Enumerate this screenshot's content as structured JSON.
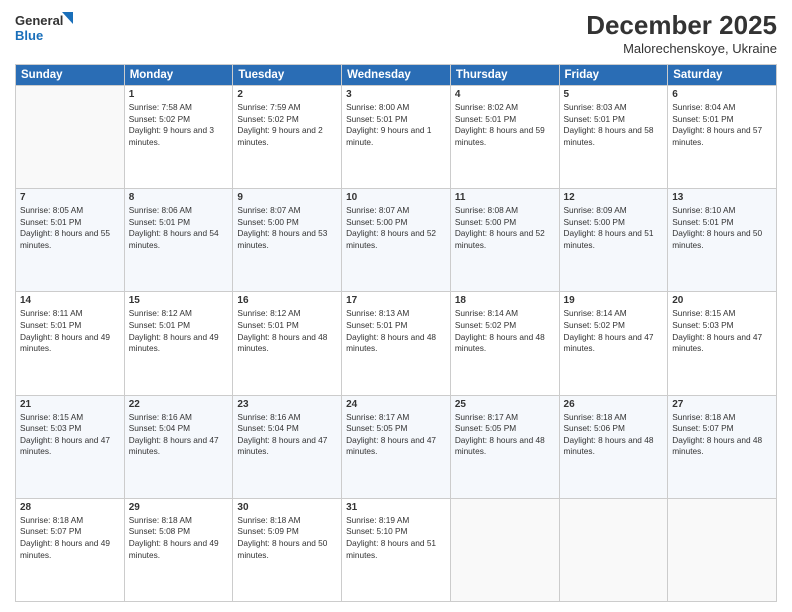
{
  "logo": {
    "line1": "General",
    "line2": "Blue"
  },
  "title": "December 2025",
  "subtitle": "Malorechenskoye, Ukraine",
  "weekdays": [
    "Sunday",
    "Monday",
    "Tuesday",
    "Wednesday",
    "Thursday",
    "Friday",
    "Saturday"
  ],
  "weeks": [
    [
      {
        "day": "",
        "sunrise": "",
        "sunset": "",
        "daylight": ""
      },
      {
        "day": "1",
        "sunrise": "Sunrise: 7:58 AM",
        "sunset": "Sunset: 5:02 PM",
        "daylight": "Daylight: 9 hours and 3 minutes."
      },
      {
        "day": "2",
        "sunrise": "Sunrise: 7:59 AM",
        "sunset": "Sunset: 5:02 PM",
        "daylight": "Daylight: 9 hours and 2 minutes."
      },
      {
        "day": "3",
        "sunrise": "Sunrise: 8:00 AM",
        "sunset": "Sunset: 5:01 PM",
        "daylight": "Daylight: 9 hours and 1 minute."
      },
      {
        "day": "4",
        "sunrise": "Sunrise: 8:02 AM",
        "sunset": "Sunset: 5:01 PM",
        "daylight": "Daylight: 8 hours and 59 minutes."
      },
      {
        "day": "5",
        "sunrise": "Sunrise: 8:03 AM",
        "sunset": "Sunset: 5:01 PM",
        "daylight": "Daylight: 8 hours and 58 minutes."
      },
      {
        "day": "6",
        "sunrise": "Sunrise: 8:04 AM",
        "sunset": "Sunset: 5:01 PM",
        "daylight": "Daylight: 8 hours and 57 minutes."
      }
    ],
    [
      {
        "day": "7",
        "sunrise": "Sunrise: 8:05 AM",
        "sunset": "Sunset: 5:01 PM",
        "daylight": "Daylight: 8 hours and 55 minutes."
      },
      {
        "day": "8",
        "sunrise": "Sunrise: 8:06 AM",
        "sunset": "Sunset: 5:01 PM",
        "daylight": "Daylight: 8 hours and 54 minutes."
      },
      {
        "day": "9",
        "sunrise": "Sunrise: 8:07 AM",
        "sunset": "Sunset: 5:00 PM",
        "daylight": "Daylight: 8 hours and 53 minutes."
      },
      {
        "day": "10",
        "sunrise": "Sunrise: 8:07 AM",
        "sunset": "Sunset: 5:00 PM",
        "daylight": "Daylight: 8 hours and 52 minutes."
      },
      {
        "day": "11",
        "sunrise": "Sunrise: 8:08 AM",
        "sunset": "Sunset: 5:00 PM",
        "daylight": "Daylight: 8 hours and 52 minutes."
      },
      {
        "day": "12",
        "sunrise": "Sunrise: 8:09 AM",
        "sunset": "Sunset: 5:00 PM",
        "daylight": "Daylight: 8 hours and 51 minutes."
      },
      {
        "day": "13",
        "sunrise": "Sunrise: 8:10 AM",
        "sunset": "Sunset: 5:01 PM",
        "daylight": "Daylight: 8 hours and 50 minutes."
      }
    ],
    [
      {
        "day": "14",
        "sunrise": "Sunrise: 8:11 AM",
        "sunset": "Sunset: 5:01 PM",
        "daylight": "Daylight: 8 hours and 49 minutes."
      },
      {
        "day": "15",
        "sunrise": "Sunrise: 8:12 AM",
        "sunset": "Sunset: 5:01 PM",
        "daylight": "Daylight: 8 hours and 49 minutes."
      },
      {
        "day": "16",
        "sunrise": "Sunrise: 8:12 AM",
        "sunset": "Sunset: 5:01 PM",
        "daylight": "Daylight: 8 hours and 48 minutes."
      },
      {
        "day": "17",
        "sunrise": "Sunrise: 8:13 AM",
        "sunset": "Sunset: 5:01 PM",
        "daylight": "Daylight: 8 hours and 48 minutes."
      },
      {
        "day": "18",
        "sunrise": "Sunrise: 8:14 AM",
        "sunset": "Sunset: 5:02 PM",
        "daylight": "Daylight: 8 hours and 48 minutes."
      },
      {
        "day": "19",
        "sunrise": "Sunrise: 8:14 AM",
        "sunset": "Sunset: 5:02 PM",
        "daylight": "Daylight: 8 hours and 47 minutes."
      },
      {
        "day": "20",
        "sunrise": "Sunrise: 8:15 AM",
        "sunset": "Sunset: 5:03 PM",
        "daylight": "Daylight: 8 hours and 47 minutes."
      }
    ],
    [
      {
        "day": "21",
        "sunrise": "Sunrise: 8:15 AM",
        "sunset": "Sunset: 5:03 PM",
        "daylight": "Daylight: 8 hours and 47 minutes."
      },
      {
        "day": "22",
        "sunrise": "Sunrise: 8:16 AM",
        "sunset": "Sunset: 5:04 PM",
        "daylight": "Daylight: 8 hours and 47 minutes."
      },
      {
        "day": "23",
        "sunrise": "Sunrise: 8:16 AM",
        "sunset": "Sunset: 5:04 PM",
        "daylight": "Daylight: 8 hours and 47 minutes."
      },
      {
        "day": "24",
        "sunrise": "Sunrise: 8:17 AM",
        "sunset": "Sunset: 5:05 PM",
        "daylight": "Daylight: 8 hours and 47 minutes."
      },
      {
        "day": "25",
        "sunrise": "Sunrise: 8:17 AM",
        "sunset": "Sunset: 5:05 PM",
        "daylight": "Daylight: 8 hours and 48 minutes."
      },
      {
        "day": "26",
        "sunrise": "Sunrise: 8:18 AM",
        "sunset": "Sunset: 5:06 PM",
        "daylight": "Daylight: 8 hours and 48 minutes."
      },
      {
        "day": "27",
        "sunrise": "Sunrise: 8:18 AM",
        "sunset": "Sunset: 5:07 PM",
        "daylight": "Daylight: 8 hours and 48 minutes."
      }
    ],
    [
      {
        "day": "28",
        "sunrise": "Sunrise: 8:18 AM",
        "sunset": "Sunset: 5:07 PM",
        "daylight": "Daylight: 8 hours and 49 minutes."
      },
      {
        "day": "29",
        "sunrise": "Sunrise: 8:18 AM",
        "sunset": "Sunset: 5:08 PM",
        "daylight": "Daylight: 8 hours and 49 minutes."
      },
      {
        "day": "30",
        "sunrise": "Sunrise: 8:18 AM",
        "sunset": "Sunset: 5:09 PM",
        "daylight": "Daylight: 8 hours and 50 minutes."
      },
      {
        "day": "31",
        "sunrise": "Sunrise: 8:19 AM",
        "sunset": "Sunset: 5:10 PM",
        "daylight": "Daylight: 8 hours and 51 minutes."
      },
      {
        "day": "",
        "sunrise": "",
        "sunset": "",
        "daylight": ""
      },
      {
        "day": "",
        "sunrise": "",
        "sunset": "",
        "daylight": ""
      },
      {
        "day": "",
        "sunrise": "",
        "sunset": "",
        "daylight": ""
      }
    ]
  ]
}
